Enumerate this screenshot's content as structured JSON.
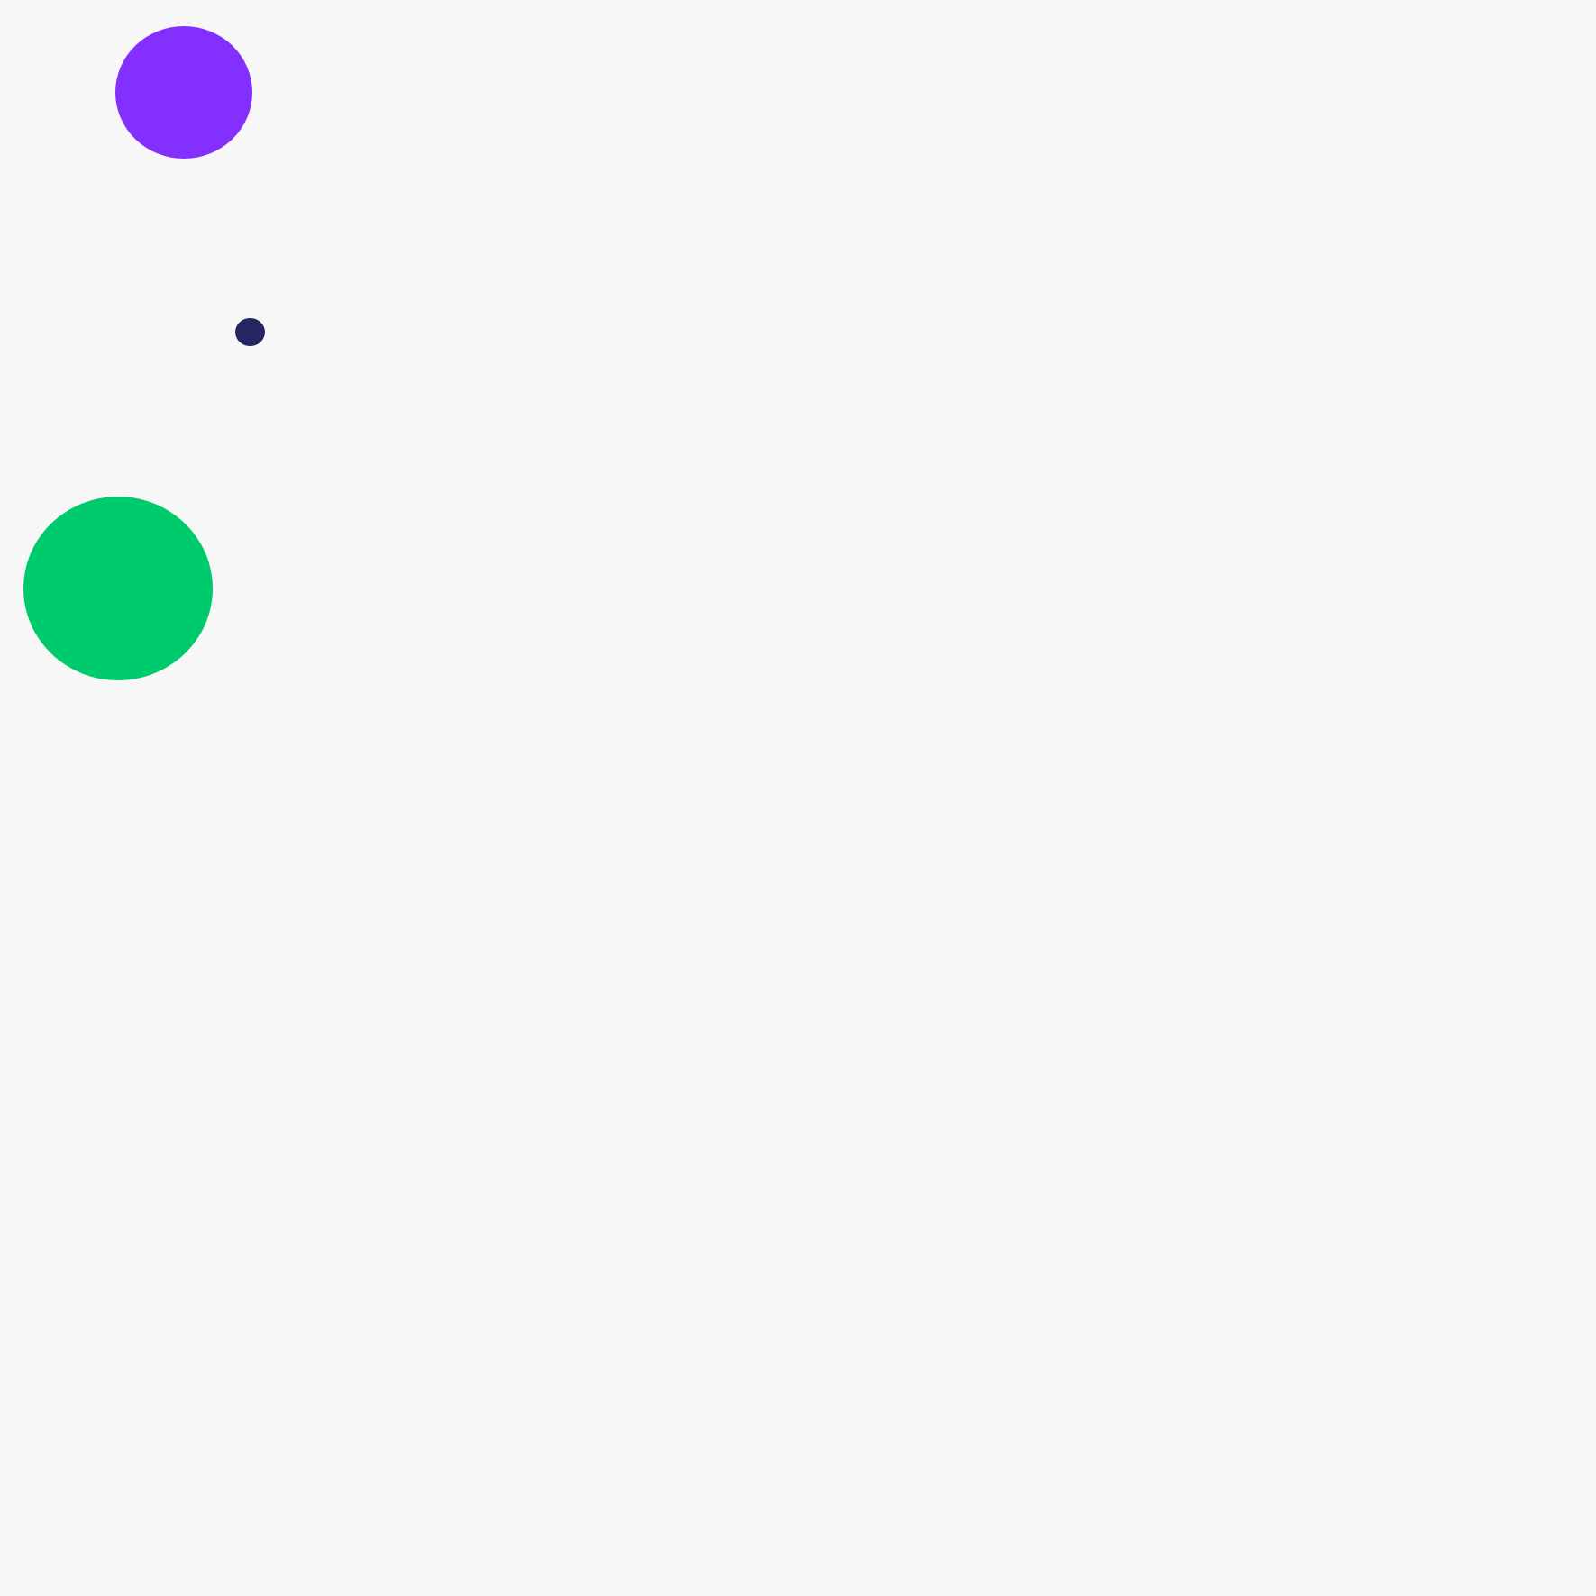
{
  "background_color": "#f7f7f7",
  "shapes": [
    {
      "name": "purple-circle",
      "shape": "circle",
      "color": "#8330ff"
    },
    {
      "name": "navy-dot",
      "shape": "circle",
      "color": "#252562"
    },
    {
      "name": "green-circle",
      "shape": "circle",
      "color": "#00cb6c"
    }
  ]
}
